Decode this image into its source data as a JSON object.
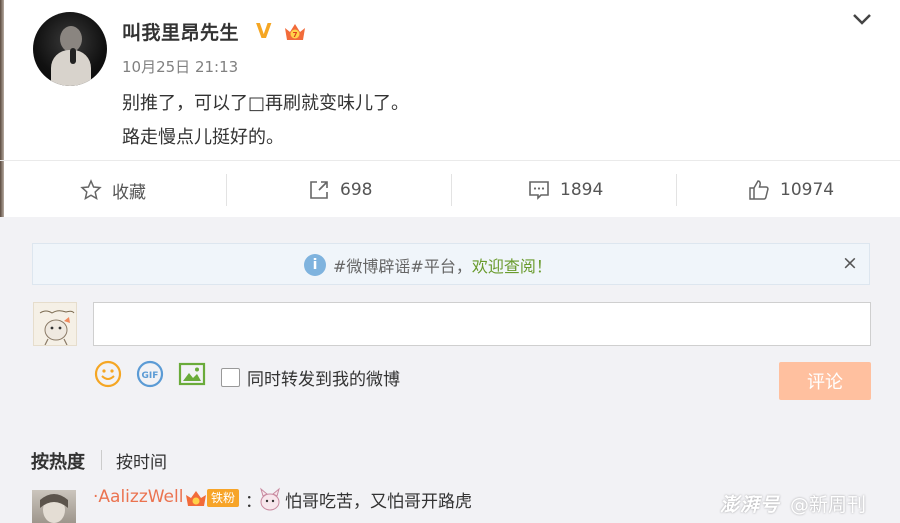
{
  "post": {
    "username": "叫我里昂先生",
    "verified_icon": "V",
    "timestamp": "10月25日 21:13",
    "text_line1": "别推了，可以了□再刷就变味儿了。",
    "text_line2": "路走慢点儿挺好的。"
  },
  "actions": {
    "favorite_label": "收藏",
    "repost_count": "698",
    "comment_count": "1894",
    "like_count": "10974"
  },
  "notice": {
    "prefix": "#微博辟谣#平台，",
    "link": "欢迎查阅！",
    "close": "×"
  },
  "composer": {
    "input_value": "",
    "repost_label": "同时转发到我的微博",
    "submit_label": "评论",
    "gif_label": "GIF"
  },
  "sort": {
    "hot_label": "按热度",
    "time_label": "按时间"
  },
  "comment": {
    "username": "·AalizzWell",
    "fan_badge": "铁粉",
    "colon": "：",
    "text": "怕哥吃苦，又怕哥开路虎"
  },
  "watermark": {
    "logo": "澎湃号",
    "label": "@新周刊"
  },
  "colors": {
    "accent_orange": "#eb7350",
    "verified_gold": "#f5a623",
    "submit_disabled": "#ffc09f",
    "notice_link": "#6a9b2d"
  }
}
